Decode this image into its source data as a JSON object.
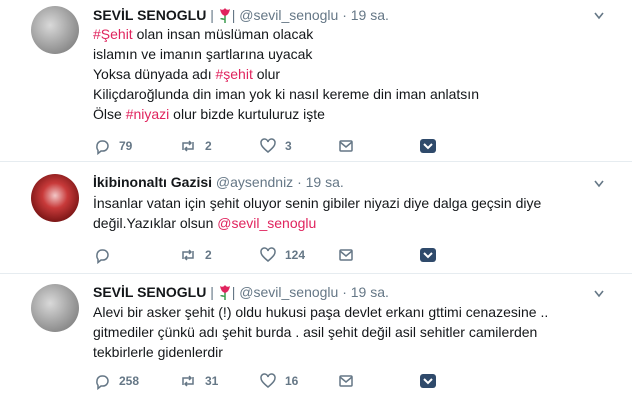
{
  "tweets": [
    {
      "display_name": "SEVİL SENOGLU",
      "separator": "|",
      "handle": "@sevil_senoglu",
      "time": "· 19 sa.",
      "text_parts": [
        {
          "type": "link",
          "text": "#Şehit"
        },
        {
          "type": "text",
          "text": " olan insan müslüman olacak\nislamın ve imanın şartlarına uyacak\nYoksa dünyada adı "
        },
        {
          "type": "link",
          "text": "#şehit"
        },
        {
          "type": "text",
          "text": " olur\nKiliçdaroğlunda din iman yok ki nasıl kereme din iman anlatsın\nÖlse "
        },
        {
          "type": "link",
          "text": "#niyazi"
        },
        {
          "type": "text",
          "text": " olur bizde kurtuluruz işte"
        }
      ],
      "replies": "79",
      "retweets": "2",
      "likes": "3"
    },
    {
      "display_name": "İkibinonaltı Gazisi",
      "separator": "",
      "handle": "@aysendniz",
      "time": "· 19 sa.",
      "text_parts": [
        {
          "type": "text",
          "text": "İnsanlar vatan için şehit oluyor senin gibiler niyazi diye dalga geçsin diye\ndeğil.Yazıklar olsun "
        },
        {
          "type": "link",
          "text": "@sevil_senoglu"
        }
      ],
      "replies": "",
      "retweets": "2",
      "likes": "124"
    },
    {
      "display_name": "SEVİL SENOGLU",
      "separator": "|",
      "handle": "@sevil_senoglu",
      "time": "· 19 sa.",
      "text_parts": [
        {
          "type": "text",
          "text": "Alevi bir asker şehit (!) oldu hukusi paşa devlet erkanı gttimi cenazesine ..\ngitmediler çünkü adı şehit burda . asil şehit değil asil sehitler camilerden\ntekbirlerle gidenlerdir"
        }
      ],
      "replies": "258",
      "retweets": "31",
      "likes": "16"
    }
  ],
  "colors": {
    "link": "#e0245e",
    "muted": "#657786",
    "text": "#14171a",
    "divider": "#e6ecf0"
  },
  "icons": [
    "reply-icon",
    "retweet-icon",
    "like-icon",
    "dm-icon",
    "caret-down-icon",
    "tulip-icon"
  ]
}
